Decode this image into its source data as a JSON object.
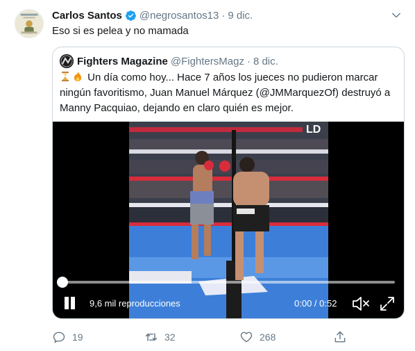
{
  "tweet": {
    "author_name": "Carlos Santos",
    "handle": "@negrosantos13",
    "separator": "·",
    "date": "9 dic.",
    "text": "Eso si es pelea y no mamada"
  },
  "quoted": {
    "author_name": "Fighters Magazine",
    "handle": "@FightersMagz",
    "separator": "·",
    "date": "8 dic.",
    "text": "Un día como hoy... Hace 7 años los jueces no pudieron marcar ningún favoritismo, Juan Manuel Márquez (@JMMarquezOf) destruyó a Manny Pacquiao, dejando en claro quién es mejor.",
    "emojis": [
      "hourglass-icon",
      "fire-icon"
    ]
  },
  "video": {
    "views": "9,6 mil reproducciones",
    "time": "0:00 / 0:52",
    "progress": 0,
    "overlay_text": "LD"
  },
  "actions": {
    "replies": "19",
    "retweets": "32",
    "likes": "268"
  },
  "colors": {
    "verified": "#1da1f2",
    "secondary_text": "#657786",
    "border": "#ccd6dd",
    "ring_blue": "#3d7fd8",
    "rope_red": "#d92c3b"
  }
}
